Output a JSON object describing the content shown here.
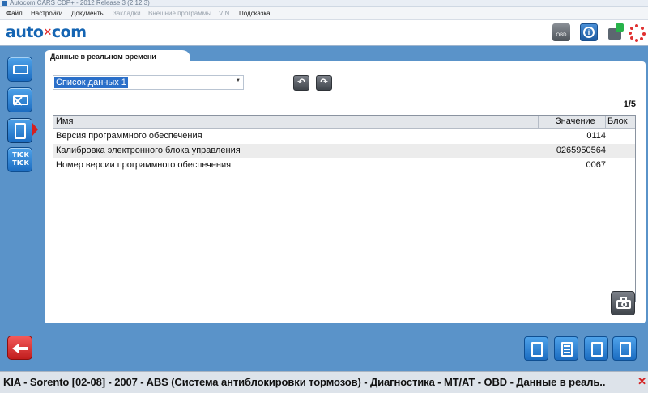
{
  "window": {
    "title": "Autocom CARS CDP+ - 2012 Release 3 (2.12.3)"
  },
  "menu": {
    "items": [
      {
        "label": "Файл",
        "enabled": true
      },
      {
        "label": "Настройки",
        "enabled": true
      },
      {
        "label": "Документы",
        "enabled": true
      },
      {
        "label": "Закладки",
        "enabled": false
      },
      {
        "label": "Внешние программы",
        "enabled": false
      },
      {
        "label": "VIN",
        "enabled": false
      },
      {
        "label": "Подсказка",
        "enabled": true
      }
    ]
  },
  "header": {
    "logo": "auto",
    "logo_suffix": "com",
    "obd_label": "OBD",
    "help_glyph": "i"
  },
  "sidebar": {
    "items": [
      {
        "icon": "engine-icon"
      },
      {
        "icon": "engine-clear-icon"
      },
      {
        "icon": "document-icon",
        "selected": true
      },
      {
        "label": "TICK TICK"
      }
    ],
    "back_icon": "back-arrow-icon"
  },
  "panel": {
    "tab_label": "Данные в реальном времени",
    "list_selector": "Список данных 1",
    "nav_prev": "↶",
    "nav_next": "↷",
    "pager": "1/5",
    "table": {
      "columns": [
        "Имя",
        "Значение",
        "Блок"
      ],
      "rows": [
        {
          "name": "Версия программного обеспечения",
          "value": "0114",
          "block": ""
        },
        {
          "name": "Калибровка электронного блока управления",
          "value": "0265950564",
          "block": ""
        },
        {
          "name": "Номер версии программного обеспечения",
          "value": "0067",
          "block": ""
        }
      ]
    }
  },
  "status_bar": {
    "text": "KIA - Sorento [02-08] - 2007 - ABS (Система антиблокировки тормозов) - Диагностика - MT/AT - OBD - Данные в реаль..",
    "close": "✕"
  },
  "colors": {
    "accent_blue": "#5a93c9",
    "button_blue": "#1b6cc1",
    "back_red": "#c11d1d",
    "logo_blue": "#1565b3"
  }
}
